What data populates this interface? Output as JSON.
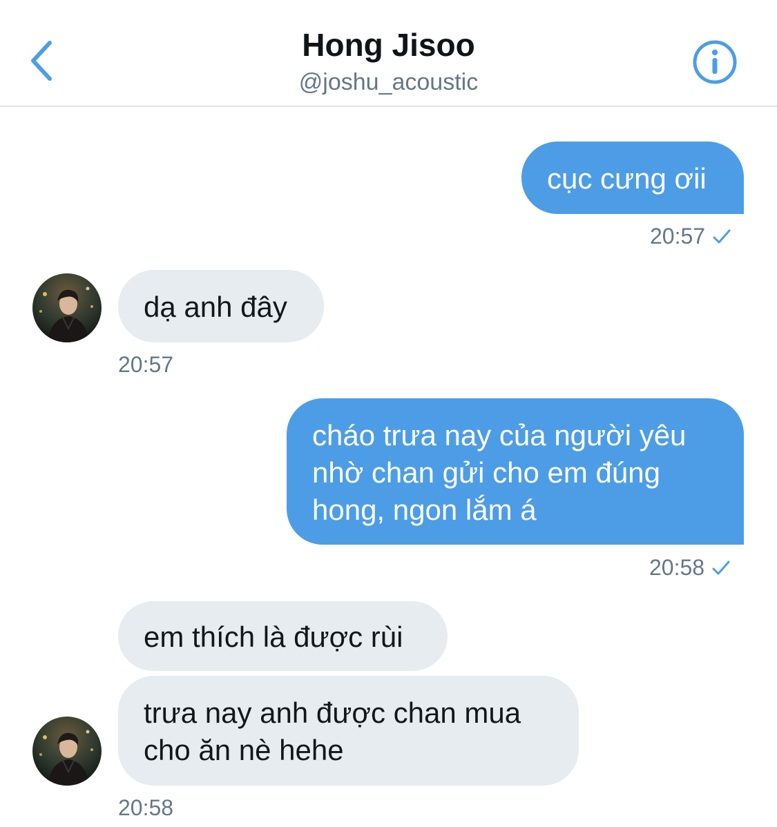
{
  "header": {
    "title": "Hong Jisoo",
    "handle": "@joshu_acoustic",
    "back_icon": "chevron-left-icon",
    "info_icon": "info-icon"
  },
  "colors": {
    "accent": "#4d9de6",
    "received_bubble": "#e6ecf0",
    "timestamp": "#657786"
  },
  "messages": [
    {
      "direction": "sent",
      "text": "cục cưng ơii"
    },
    {
      "direction": "received",
      "text": "dạ anh đây"
    },
    {
      "direction": "sent",
      "text": "cháo trưa nay của người yêu nhờ chan gửi cho em đúng hong, ngon lắm á"
    },
    {
      "direction": "received",
      "text": "em thích là được rùi"
    },
    {
      "direction": "received",
      "text": "trưa nay anh được chan mua cho ăn nè hehe"
    }
  ],
  "timestamps": [
    {
      "time": "20:57",
      "seen": true
    },
    {
      "time": "20:57",
      "seen": false
    },
    {
      "time": "20:58",
      "seen": true
    },
    {
      "time": "20:58",
      "seen": false
    }
  ]
}
